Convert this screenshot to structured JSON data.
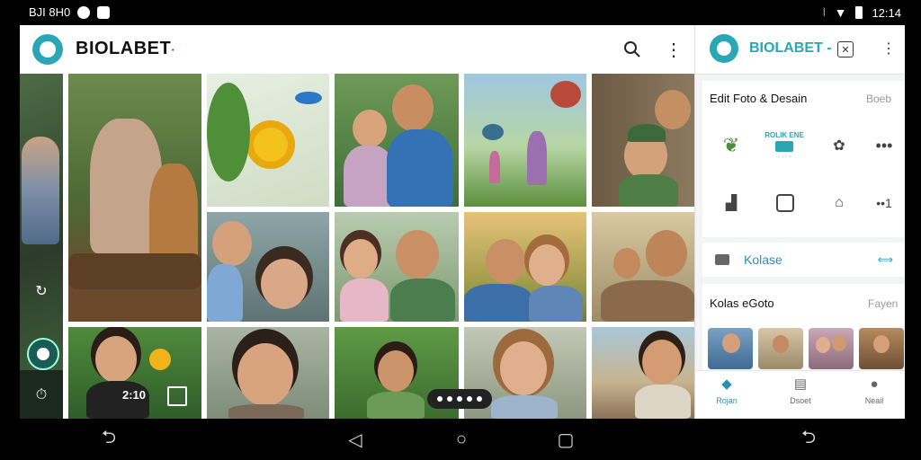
{
  "status_bar": {
    "left_text": "BJI 8H0",
    "left_icons": [
      "whatsapp-icon",
      "image-notification-icon"
    ],
    "right_icons": [
      "vibrate-icon",
      "wifi-icon",
      "battery-icon"
    ],
    "time": "12:14"
  },
  "header": {
    "app_name": "BIOLABET",
    "app_name_suffix": "·"
  },
  "colors": {
    "accent": "#2aa7b5",
    "panel_bg": "#f3f4f6",
    "text_dark": "#111111"
  },
  "photo_grid": {
    "tiles": [
      {
        "subject": "tiger-cat-photo"
      },
      {
        "subject": "sunflower-bird-photo"
      },
      {
        "subject": "father-daughter-photo"
      },
      {
        "subject": "park-birds-photo"
      },
      {
        "subject": "boy-cap-photo"
      },
      {
        "subject": "mother-girl-photo"
      },
      {
        "subject": "family-cat-photo"
      },
      {
        "subject": "couple-sunset-photo"
      },
      {
        "subject": "father-child-photo"
      },
      {
        "subject": "girl-flowers-photo"
      },
      {
        "subject": "boy-portrait-photo"
      },
      {
        "subject": "boy-leaves-photo"
      },
      {
        "subject": "girl-smile-photo"
      },
      {
        "subject": "boy-sea-photo"
      }
    ],
    "overlay_counter": "2:10"
  },
  "panel": {
    "app_name": "BIOLABET -",
    "edit_section": {
      "title": "Edit Foto & Desain",
      "link": "Boeb",
      "banner_text": "ROLIK ENE",
      "banner_sub": "·· ·· ··"
    },
    "kolase_label": "Kolase",
    "kolase_foto": {
      "title": "Kolas eGoto",
      "link": "Fayen"
    },
    "bottom_nav": [
      {
        "label": "Rojan",
        "icon": "home-icon"
      },
      {
        "label": "Dsoet",
        "icon": "gallery-icon"
      },
      {
        "label": "Neail",
        "icon": "profile-icon"
      }
    ]
  }
}
